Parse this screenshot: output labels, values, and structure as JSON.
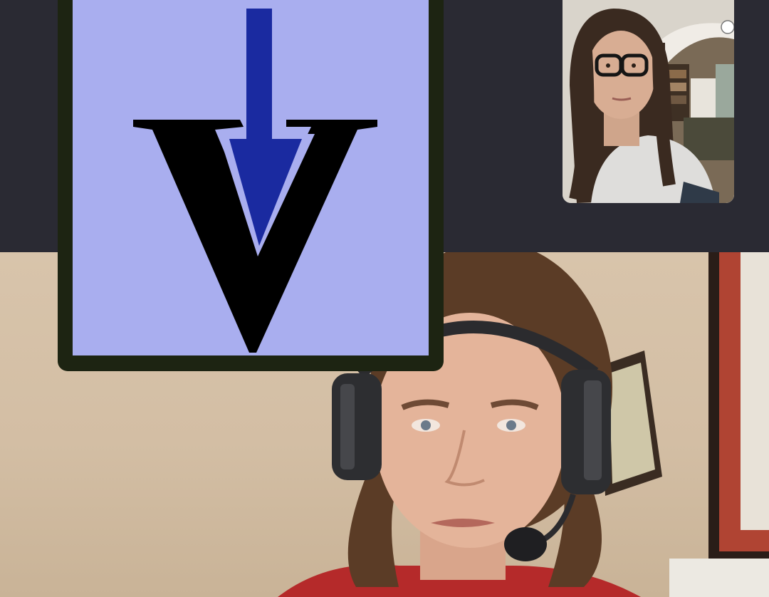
{
  "app": {
    "title": "",
    "layout": "speaker-view"
  },
  "participants": {
    "main_speaker": {
      "name": "",
      "video_on": true,
      "headset": true
    },
    "self_view": {
      "name": "",
      "video_on": true
    }
  },
  "shared_tile": {
    "type": "logo",
    "letter": "V",
    "icon": "down-arrow-icon"
  },
  "colors": {
    "background": "#2a2a33",
    "logo_background": "#a9aeef",
    "logo_frame": "#1d2412",
    "logo_letter": "#000000",
    "logo_arrow": "#1a2aa0"
  }
}
